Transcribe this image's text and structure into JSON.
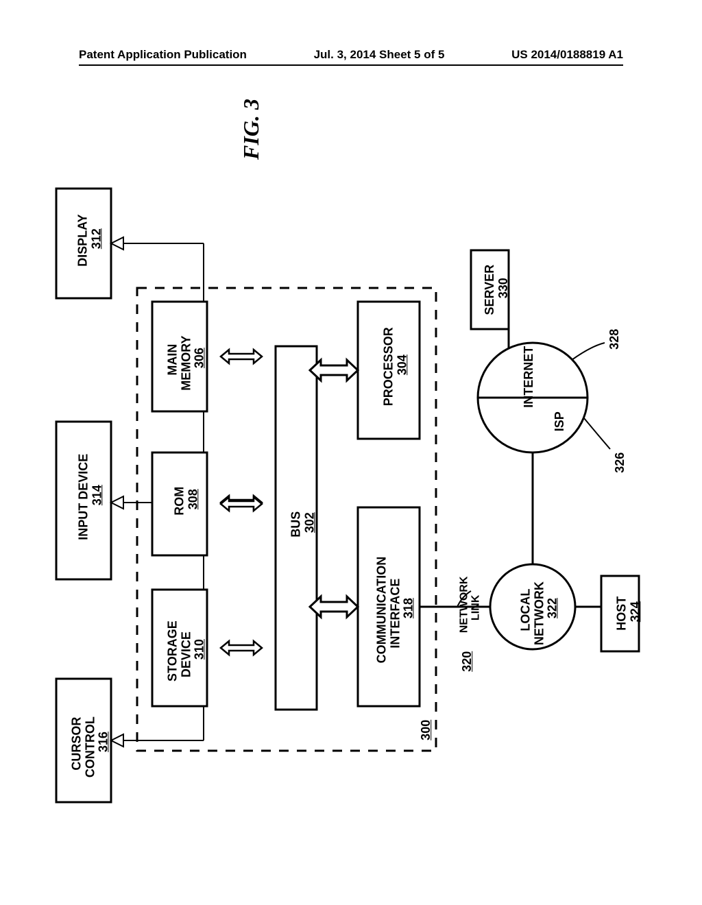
{
  "header": {
    "left": "Patent Application Publication",
    "center": "Jul. 3, 2014   Sheet 5 of 5",
    "right": "US 2014/0188819 A1"
  },
  "figure": {
    "title": "FIG. 3",
    "blocks": {
      "display": {
        "label": "DISPLAY",
        "num": "312"
      },
      "input": {
        "label": "INPUT DEVICE",
        "num": "314"
      },
      "cursor": {
        "label": "CURSOR\nCONTROL",
        "num": "316"
      },
      "main_mem": {
        "label": "MAIN\nMEMORY",
        "num": "306"
      },
      "rom": {
        "label": "ROM",
        "num": "308"
      },
      "storage": {
        "label": "STORAGE\nDEVICE",
        "num": "310"
      },
      "bus": {
        "label": "BUS",
        "num": "302"
      },
      "processor": {
        "label": "PROCESSOR",
        "num": "304"
      },
      "comm": {
        "label": "COMMUNICATION\nINTERFACE",
        "num": "318"
      },
      "system": {
        "num": "300"
      },
      "server": {
        "label": "SERVER",
        "num": "330"
      },
      "internet": {
        "label": "INTERNET",
        "num": "328"
      },
      "isp": {
        "label": "ISP",
        "num": "326"
      },
      "local_net": {
        "label": "LOCAL\nNETWORK",
        "num": "322"
      },
      "host": {
        "label": "HOST",
        "num": "324"
      },
      "net_link": {
        "label": "NETWORK\nLINK",
        "num": "320"
      }
    }
  }
}
